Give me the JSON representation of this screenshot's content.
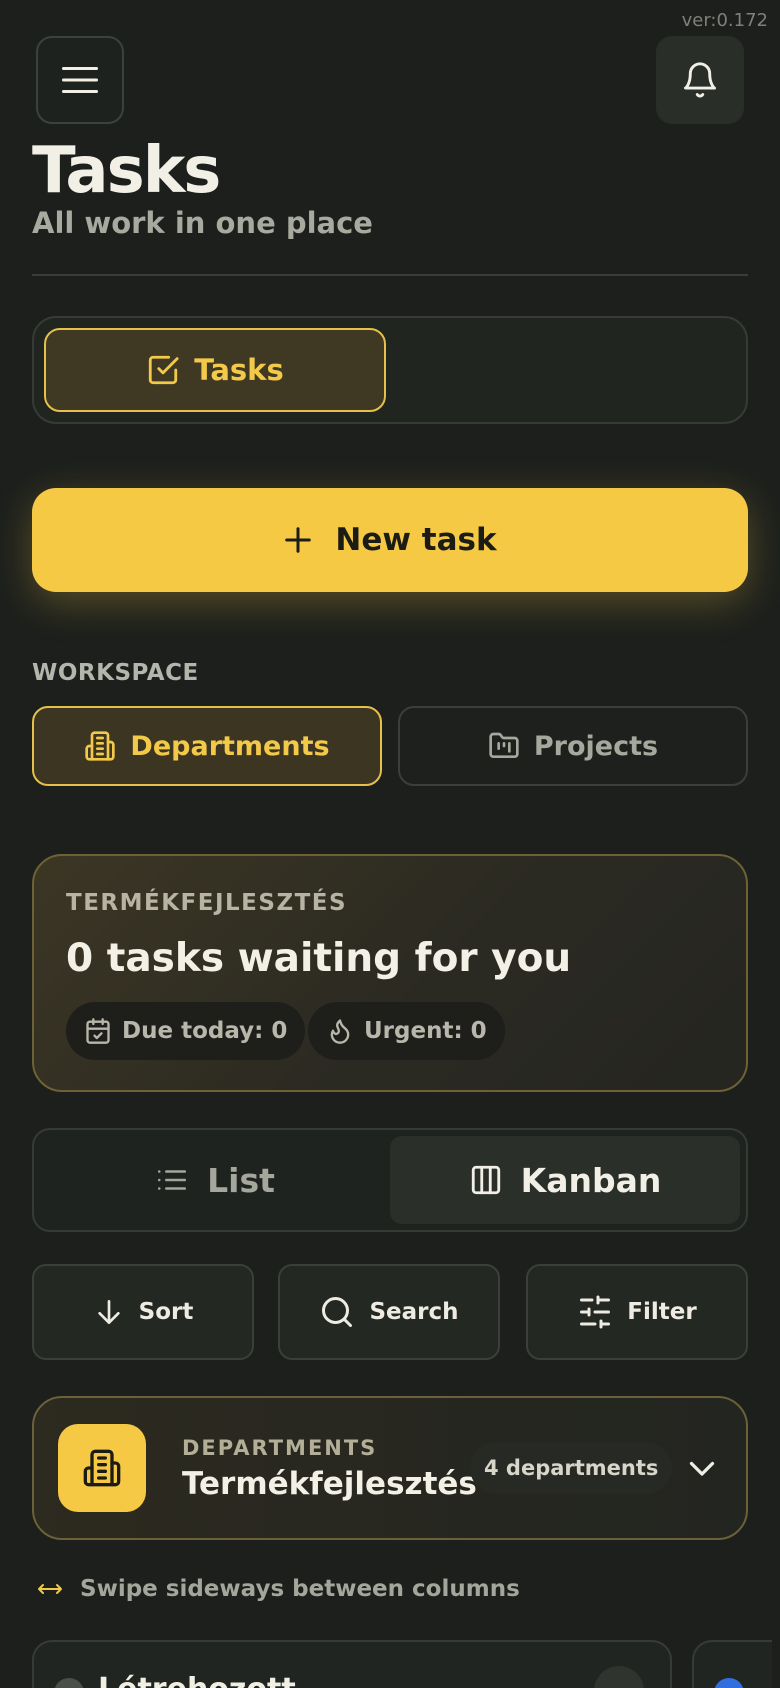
{
  "version": "ver:0.172",
  "header": {
    "title": "Tasks",
    "subtitle": "All work in one place"
  },
  "tabs": [
    {
      "label": "Tasks",
      "icon": "checkbox-icon",
      "active": true
    }
  ],
  "new_task_label": "New task",
  "workspace": {
    "label": "WORKSPACE",
    "options": [
      {
        "label": "Departments",
        "icon": "building-icon",
        "active": true
      },
      {
        "label": "Projects",
        "icon": "folder-icon",
        "active": false
      }
    ]
  },
  "summary": {
    "department": "TERMÉKFEJLESZTÉS",
    "headline": "0 tasks waiting for you",
    "due_today": "Due today: 0",
    "urgent": "Urgent: 0"
  },
  "views": [
    {
      "label": "List",
      "icon": "list-icon",
      "active": false
    },
    {
      "label": "Kanban",
      "icon": "columns-icon",
      "active": true
    }
  ],
  "tools": {
    "sort": "Sort",
    "search": "Search",
    "filter": "Filter"
  },
  "department_card": {
    "kicker": "DEPARTMENTS",
    "name": "Termékfejlesztés",
    "count": "4 departments"
  },
  "swipe_hint": "Swipe sideways between columns",
  "column": {
    "title": "Létrehozott"
  },
  "colors": {
    "accent": "#f6c945",
    "background": "#1c1f1c"
  }
}
